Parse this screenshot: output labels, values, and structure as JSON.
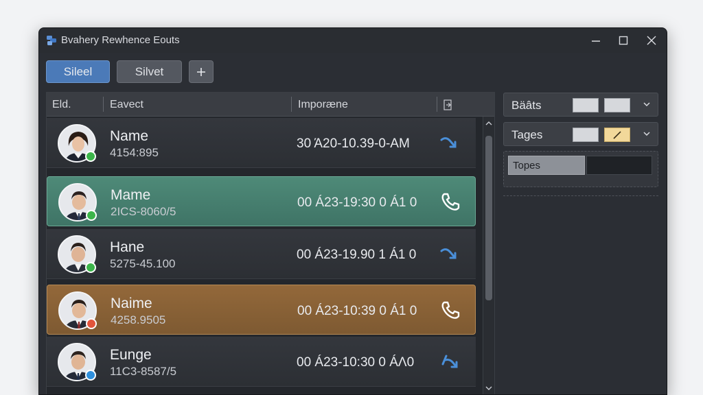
{
  "window": {
    "title": "Bvahery Rewhence Eouts"
  },
  "toolbar": {
    "select_label": "Sileel",
    "select2_label": "Silvet",
    "add_label": "+"
  },
  "list": {
    "columns": [
      "Eld.",
      "Eavect",
      "Imporæne"
    ],
    "rows": [
      {
        "name": "Name",
        "number": "4154:895",
        "time": "30 Ά20-10.39-0-AM",
        "status": "online",
        "icon": "missed-call-icon"
      },
      {
        "name": "Mame",
        "number": "2ICS-8060/5",
        "time": "00 Á23-19:30 0 Á1 0",
        "status": "online",
        "icon": "phone-icon"
      },
      {
        "name": "Hane",
        "number": "5275-45.100",
        "time": "00 Á23-19.90 1 Á1 0",
        "status": "online",
        "icon": "missed-call-icon"
      },
      {
        "name": "Naime",
        "number": "4258.9505",
        "time": "00 Á23-10:39 0 Á1 0",
        "status": "busy",
        "icon": "phone-icon"
      },
      {
        "name": "Eunge",
        "number": "11C3-8587/5",
        "time": "00 Á23-10:30 0 ÁΛ0",
        "status": "away",
        "icon": "outgoing-call-icon"
      }
    ]
  },
  "sidebar": {
    "badges_label": "Bäâts",
    "tags_label": "Tages",
    "types_label": "Topes"
  },
  "colors": {
    "accent": "#4b7ab8",
    "online": "#3cb54a",
    "busy": "#e2553c",
    "away": "#2f8fdc",
    "selected_green": "#4e8a78",
    "selected_orange": "#93683a"
  }
}
